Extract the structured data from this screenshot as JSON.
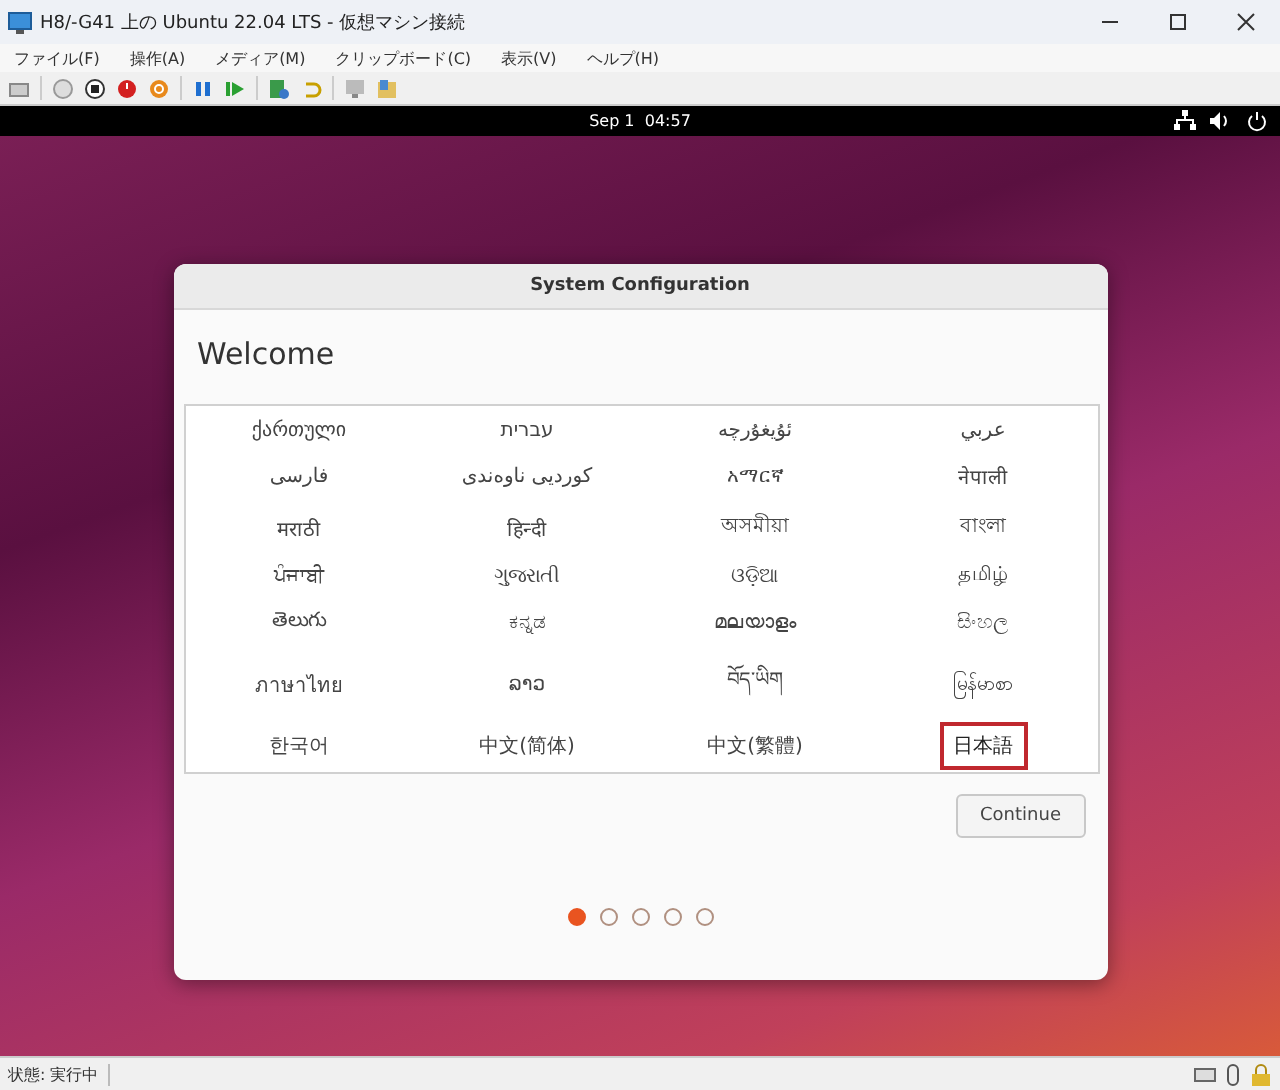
{
  "window": {
    "title": "H8/-G41 上の Ubuntu 22.04 LTS - 仮想マシン接続"
  },
  "menu": [
    "ファイル(F)",
    "操作(A)",
    "メディア(M)",
    "クリップボード(C)",
    "表示(V)",
    "ヘルプ(H)"
  ],
  "top_bar": {
    "clock": "Sep 1  04:57"
  },
  "dialog": {
    "title": "System Configuration",
    "heading": "Welcome",
    "languages": [
      {
        "label": "ქართული",
        "selected": false
      },
      {
        "label": "עברית",
        "selected": false
      },
      {
        "label": "ئۇيغۇرچە",
        "selected": false
      },
      {
        "label": "عربي",
        "selected": false
      },
      {
        "label": "فارسی",
        "selected": false
      },
      {
        "label": "کوردیی ناوەندی",
        "selected": false
      },
      {
        "label": "አማርኛ",
        "selected": false
      },
      {
        "label": "नेपाली",
        "selected": false
      },
      {
        "label": "मराठी",
        "selected": false
      },
      {
        "label": "हिन्दी",
        "selected": false
      },
      {
        "label": "অসমীয়া",
        "selected": false
      },
      {
        "label": "বাংলা",
        "selected": false
      },
      {
        "label": "ਪੰਜਾਬੀ",
        "selected": false
      },
      {
        "label": "ગુજરાતી",
        "selected": false
      },
      {
        "label": "ଓଡ଼ିଆ",
        "selected": false
      },
      {
        "label": "தமிழ்",
        "selected": false
      },
      {
        "label": "తెలుగు",
        "selected": false
      },
      {
        "label": "ಕನ್ನಡ",
        "selected": false
      },
      {
        "label": "മലയാളം",
        "selected": false
      },
      {
        "label": "සිංහල",
        "selected": false
      },
      {
        "label": "ภาษาไทย",
        "selected": false
      },
      {
        "label": "ລາວ",
        "selected": false
      },
      {
        "label": "བོད་ཡིག",
        "selected": false
      },
      {
        "label": "မြန်မာစာ",
        "selected": false
      },
      {
        "label": "한국어",
        "selected": false
      },
      {
        "label": "中文(简体)",
        "selected": false
      },
      {
        "label": "中文(繁體)",
        "selected": false
      },
      {
        "label": "日本語",
        "selected": true
      }
    ],
    "continue_button": "Continue",
    "pages": [
      {
        "selected": true
      },
      {
        "selected": false
      },
      {
        "selected": false
      },
      {
        "selected": false
      },
      {
        "selected": false
      }
    ]
  },
  "status_bar": {
    "status": "状態: 実行中"
  }
}
